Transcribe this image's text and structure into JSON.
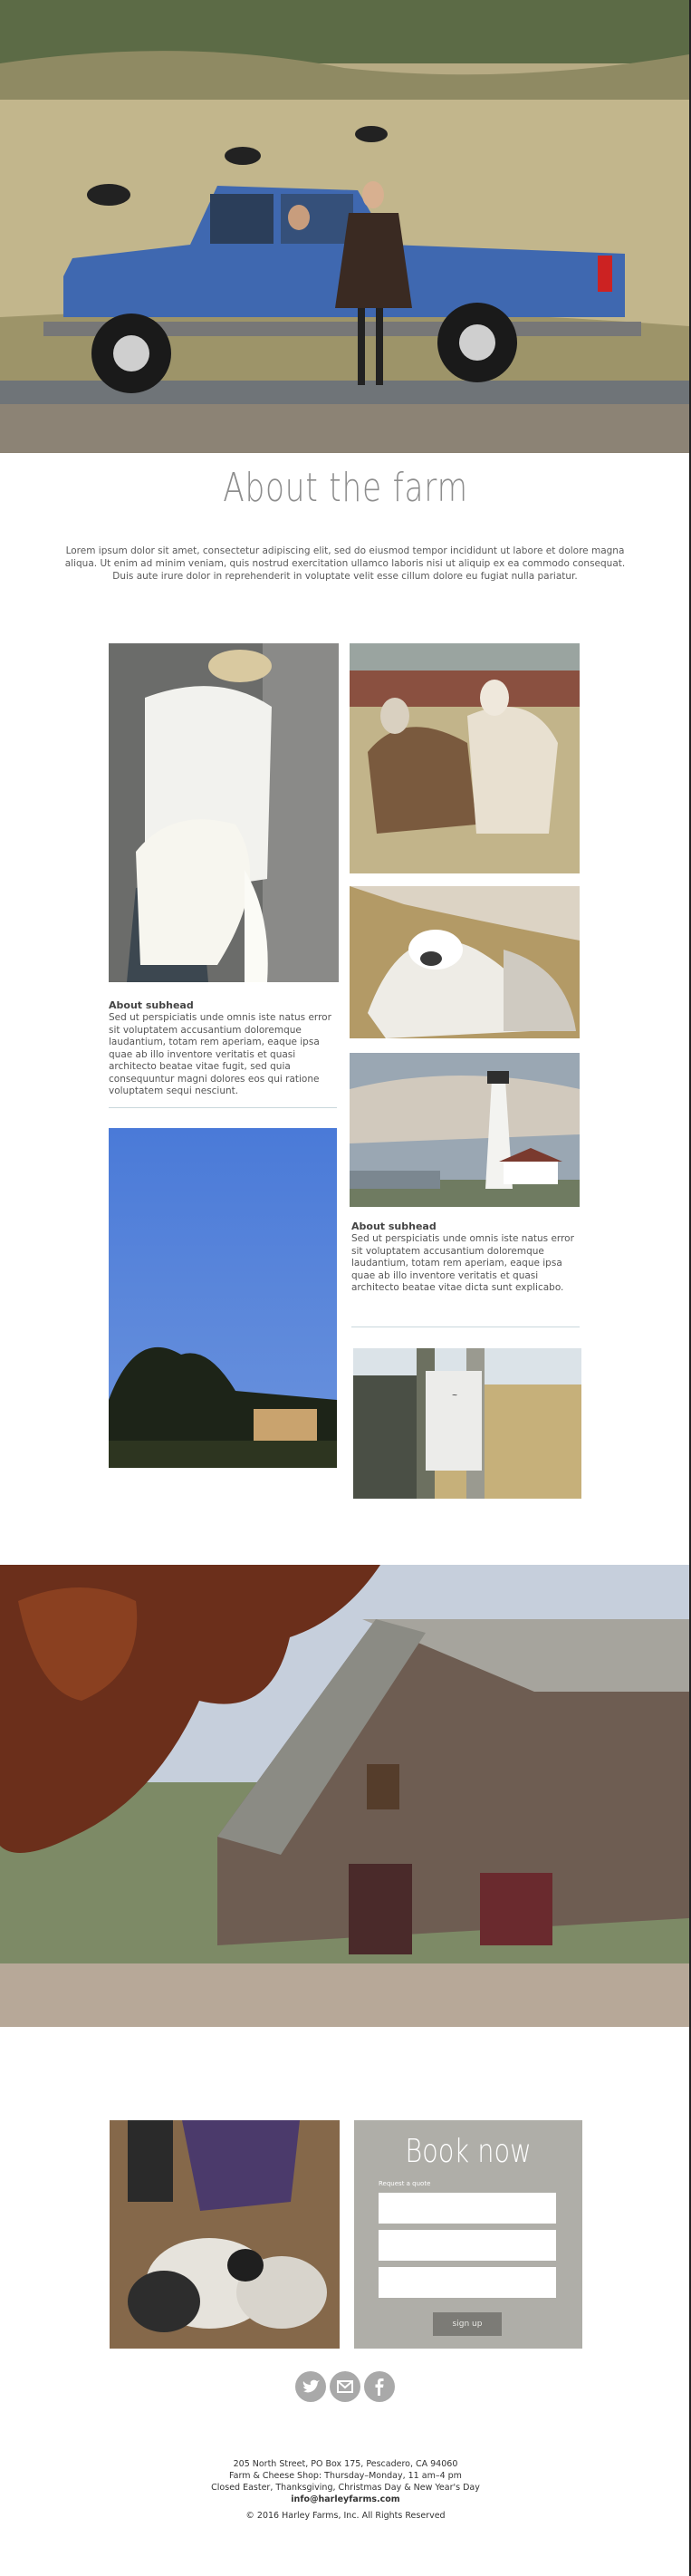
{
  "about": {
    "title": "About the farm",
    "body": "Lorem ipsum dolor sit amet, consectetur adipiscing elit, sed do eiusmod tempor incididunt ut labore et dolore magna aliqua. Ut enim ad minim veniam, quis nostrud exercitation ullamco laboris nisi ut aliquip ex ea commodo consequat. Duis aute irure dolor in reprehenderit in voluptate velit esse cillum dolore eu fugiat nulla pariatur."
  },
  "gallery": {
    "left_subhead": "About subhead",
    "left_text": "Sed ut perspiciatis unde omnis iste natus error sit voluptatem accusantium doloremque laudantium, totam rem aperiam, eaque ipsa quae ab illo inventore veritatis et quasi architecto beatae vitae fugit, sed quia consequuntur magni dolores eos qui ratione voluptatem sequi nesciunt.",
    "right_subhead": "About subhead",
    "right_text": "Sed ut perspiciatis unde omnis iste natus error sit voluptatem accusantium doloremque laudantium, totam rem aperiam, eaque ipsa quae ab illo inventore veritatis et quasi architecto beatae vitae dicta sunt explicabo."
  },
  "booking": {
    "title": "Book now",
    "label": "Request a quote",
    "fields": [
      "",
      "",
      ""
    ],
    "signup": "sign up"
  },
  "social": [
    "twitter-icon",
    "mail-icon",
    "facebook-icon"
  ],
  "footer": {
    "address": "205 North Street, PO Box 175, Pescadero, CA 94060",
    "hours": "Farm & Cheese Shop: Thursday–Monday, 11 am–4 pm",
    "closed": "Closed Easter, Thanksgiving, Christmas Day & New Year's Day",
    "email": "info@harleyfarms.com",
    "copyright": "© 2016 Harley Farms, Inc. All Rights Reserved"
  }
}
